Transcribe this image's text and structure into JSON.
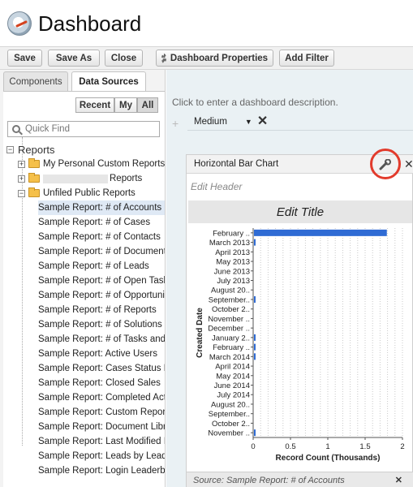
{
  "app": {
    "title": "Dashboard"
  },
  "toolbar": {
    "save": "Save",
    "save_as": "Save As",
    "close": "Close",
    "dashboard_properties": "Dashboard Properties",
    "add_filter": "Add Filter"
  },
  "left_tabs": {
    "components": "Components",
    "data_sources": "Data Sources"
  },
  "filters": {
    "recent": "Recent",
    "my": "My",
    "all": "All",
    "selected": "All"
  },
  "quick_find": {
    "placeholder": "Quick Find"
  },
  "tree": {
    "root": "Reports",
    "folders": [
      "My Personal Custom Reports",
      "Reports",
      "Unfiled Public Reports"
    ],
    "reports": [
      "Sample Report: # of Accounts",
      "Sample Report: # of Cases",
      "Sample Report: # of Contacts",
      "Sample Report: # of Documents",
      "Sample Report: # of Leads",
      "Sample Report: # of Open Tasks",
      "Sample Report: # of Opportunities",
      "Sample Report: # of Reports",
      "Sample Report: # of Solutions",
      "Sample Report: # of Tasks and",
      "Sample Report: Active Users",
      "Sample Report: Cases Status I",
      "Sample Report: Closed Sales",
      "Sample Report: Completed Act",
      "Sample Report: Custom Repor",
      "Sample Report: Document Libr",
      "Sample Report: Last Modified I",
      "Sample Report: Leads by Lead",
      "Sample Report: Login Leaderb"
    ]
  },
  "canvas": {
    "description": "Click to enter a dashboard description.",
    "column_size": "Medium"
  },
  "component": {
    "type": "Horizontal Bar Chart",
    "edit_header": "Edit Header",
    "edit_title": "Edit Title",
    "footer": "Source: Sample Report: # of Accounts"
  },
  "chart_data": {
    "type": "bar",
    "orientation": "horizontal",
    "xlabel": "Record Count (Thousands)",
    "ylabel": "Created Date",
    "xlim": [
      0,
      2
    ],
    "xticks": [
      "0",
      "0.5",
      "1",
      "1.5",
      "2"
    ],
    "grid": true,
    "categories": [
      "February ..",
      "March 2013",
      "April 2013",
      "May 2013",
      "June 2013",
      "July 2013",
      "August 20..",
      "September..",
      "October 2..",
      "November ..",
      "December ..",
      "January 2..",
      "February ..",
      "March 2014",
      "April 2014",
      "May 2014",
      "June 2014",
      "July 2014",
      "August 20..",
      "September..",
      "October 2..",
      "November .."
    ],
    "values": [
      1.78,
      0.02,
      0,
      0,
      0,
      0,
      0,
      0.01,
      0,
      0,
      0,
      0.01,
      0.02,
      0.01,
      0,
      0,
      0,
      0,
      0,
      0,
      0,
      0.01
    ],
    "bar_color": "#2f6bd4"
  }
}
